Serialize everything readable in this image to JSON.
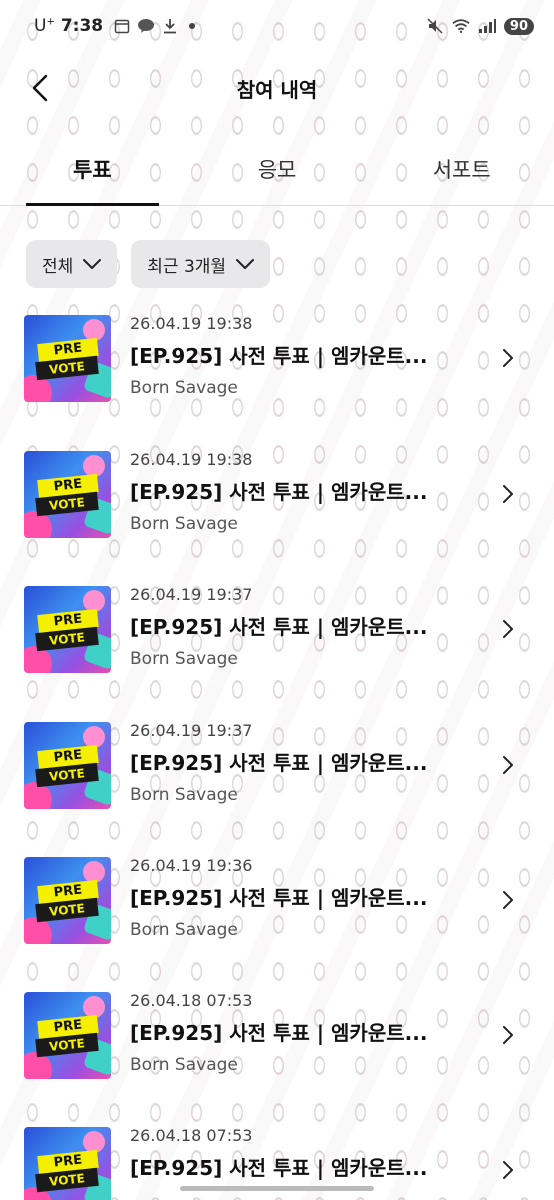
{
  "status_bar": {
    "carrier": "U",
    "carrier_sup": "+",
    "time": "7:38",
    "battery": "90"
  },
  "header": {
    "title": "참여 내역"
  },
  "tabs": [
    {
      "label": "투표",
      "active": true
    },
    {
      "label": "응모",
      "active": false
    },
    {
      "label": "서포트",
      "active": false
    }
  ],
  "filters": {
    "category": "전체",
    "period": "최근 3개월"
  },
  "items": [
    {
      "date": "26.04.19 19:38",
      "title": "[EP.925] 사전 투표 | 엠카운트...",
      "artist": "Born Savage",
      "thumb_top": "PRE",
      "thumb_bottom": "VOTE"
    },
    {
      "date": "26.04.19 19:38",
      "title": "[EP.925] 사전 투표 | 엠카운트...",
      "artist": "Born Savage",
      "thumb_top": "PRE",
      "thumb_bottom": "VOTE"
    },
    {
      "date": "26.04.19 19:37",
      "title": "[EP.925] 사전 투표 | 엠카운트...",
      "artist": "Born Savage",
      "thumb_top": "PRE",
      "thumb_bottom": "VOTE"
    },
    {
      "date": "26.04.19 19:37",
      "title": "[EP.925] 사전 투표 | 엠카운트...",
      "artist": "Born Savage",
      "thumb_top": "PRE",
      "thumb_bottom": "VOTE"
    },
    {
      "date": "26.04.19 19:36",
      "title": "[EP.925] 사전 투표 | 엠카운트...",
      "artist": "Born Savage",
      "thumb_top": "PRE",
      "thumb_bottom": "VOTE"
    },
    {
      "date": "26.04.18 07:53",
      "title": "[EP.925] 사전 투표 | 엠카운트...",
      "artist": "Born Savage",
      "thumb_top": "PRE",
      "thumb_bottom": "VOTE"
    },
    {
      "date": "26.04.18 07:53",
      "title": "[EP.925] 사전 투표 | 엠카운트...",
      "artist": "",
      "thumb_top": "PRE",
      "thumb_bottom": "VOTE"
    }
  ]
}
